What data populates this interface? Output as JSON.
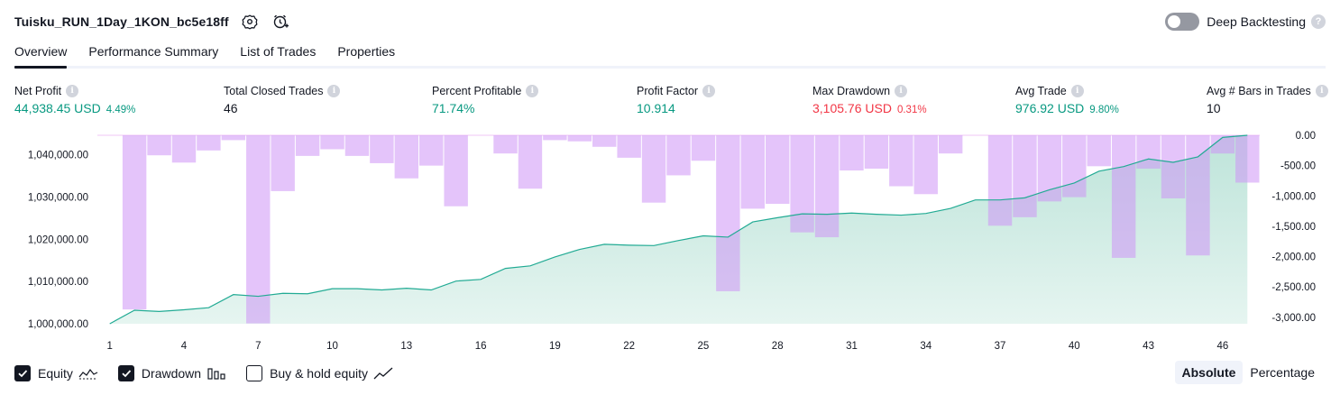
{
  "header": {
    "strategy_name": "Tuisku_RUN_1Day_1KON_bc5e18ff",
    "deep_backtesting_label": "Deep Backtesting",
    "deep_backtesting_enabled": false,
    "help_glyph": "?"
  },
  "tabs": [
    {
      "label": "Overview",
      "active": true
    },
    {
      "label": "Performance Summary",
      "active": false
    },
    {
      "label": "List of Trades",
      "active": false
    },
    {
      "label": "Properties",
      "active": false
    }
  ],
  "metrics": {
    "net_profit": {
      "label": "Net Profit",
      "value": "44,938.45 USD",
      "pct": "4.49%"
    },
    "total_closed_trades": {
      "label": "Total Closed Trades",
      "value": "46"
    },
    "percent_profitable": {
      "label": "Percent Profitable",
      "value": "71.74%"
    },
    "profit_factor": {
      "label": "Profit Factor",
      "value": "10.914"
    },
    "max_drawdown": {
      "label": "Max Drawdown",
      "value": "3,105.76 USD",
      "pct": "0.31%"
    },
    "avg_trade": {
      "label": "Avg Trade",
      "value": "976.92 USD",
      "pct": "9.80%"
    },
    "avg_bars_in_trades": {
      "label": "Avg # Bars in Trades",
      "value": "10"
    }
  },
  "colors": {
    "positive": "#089981",
    "negative": "#f23645",
    "equity_line": "#22ab94",
    "drawdown_bar": "#ce93f5"
  },
  "chart_data": {
    "type": "area",
    "x": [
      1,
      2,
      3,
      4,
      5,
      6,
      7,
      8,
      9,
      10,
      11,
      12,
      13,
      14,
      15,
      16,
      17,
      18,
      19,
      20,
      21,
      22,
      23,
      24,
      25,
      26,
      27,
      28,
      29,
      30,
      31,
      32,
      33,
      34,
      35,
      36,
      37,
      38,
      39,
      40,
      41,
      42,
      43,
      44,
      45,
      46,
      47
    ],
    "x_ticks": [
      "1",
      "4",
      "7",
      "10",
      "13",
      "16",
      "19",
      "22",
      "25",
      "28",
      "31",
      "34",
      "37",
      "40",
      "43",
      "46"
    ],
    "series": [
      {
        "name": "Equity",
        "type": "area",
        "axis": "left",
        "values": [
          1000000,
          1003200,
          1002900,
          1003300,
          1003800,
          1006900,
          1006500,
          1007200,
          1007100,
          1008300,
          1008300,
          1008000,
          1008400,
          1008000,
          1010100,
          1010500,
          1013100,
          1013700,
          1015800,
          1017600,
          1018800,
          1018600,
          1018500,
          1019700,
          1020800,
          1020500,
          1024100,
          1025100,
          1026000,
          1025900,
          1026200,
          1025900,
          1025700,
          1026100,
          1027300,
          1029300,
          1029300,
          1029800,
          1031700,
          1033300,
          1036100,
          1037200,
          1039000,
          1038200,
          1039500,
          1044100,
          1044600
        ]
      },
      {
        "name": "Drawdown",
        "type": "bar",
        "axis": "right",
        "values": [
          0,
          -2870,
          -330,
          -450,
          -250,
          -80,
          -3100,
          -920,
          -340,
          -230,
          -340,
          -460,
          -710,
          -500,
          -1170,
          0,
          -300,
          -880,
          -80,
          -100,
          -190,
          -370,
          -1110,
          -660,
          -420,
          -2570,
          -1210,
          -1130,
          -1600,
          -1680,
          -580,
          -550,
          -840,
          -970,
          -300,
          0,
          -1490,
          -1350,
          -1090,
          -1020,
          -510,
          -2020,
          -550,
          -1040,
          -1980,
          -300,
          -780
        ]
      }
    ],
    "y_left_ticks": [
      "1,000,000.00",
      "1,010,000.00",
      "1,020,000.00",
      "1,030,000.00",
      "1,040,000.00"
    ],
    "y_left_range": [
      1000000,
      1044600
    ],
    "y_right_ticks": [
      "0.00",
      "-500.00",
      "-1,000.00",
      "-1,500.00",
      "-2,000.00",
      "-2,500.00",
      "-3,000.00"
    ],
    "y_right_range": [
      -3105.76,
      0
    ],
    "grid": false
  },
  "legend": {
    "equity": {
      "label": "Equity",
      "checked": true
    },
    "drawdown": {
      "label": "Drawdown",
      "checked": true
    },
    "buy_hold": {
      "label": "Buy & hold equity",
      "checked": false
    }
  },
  "modes": {
    "absolute": "Absolute",
    "percentage": "Percentage",
    "active": "absolute"
  }
}
